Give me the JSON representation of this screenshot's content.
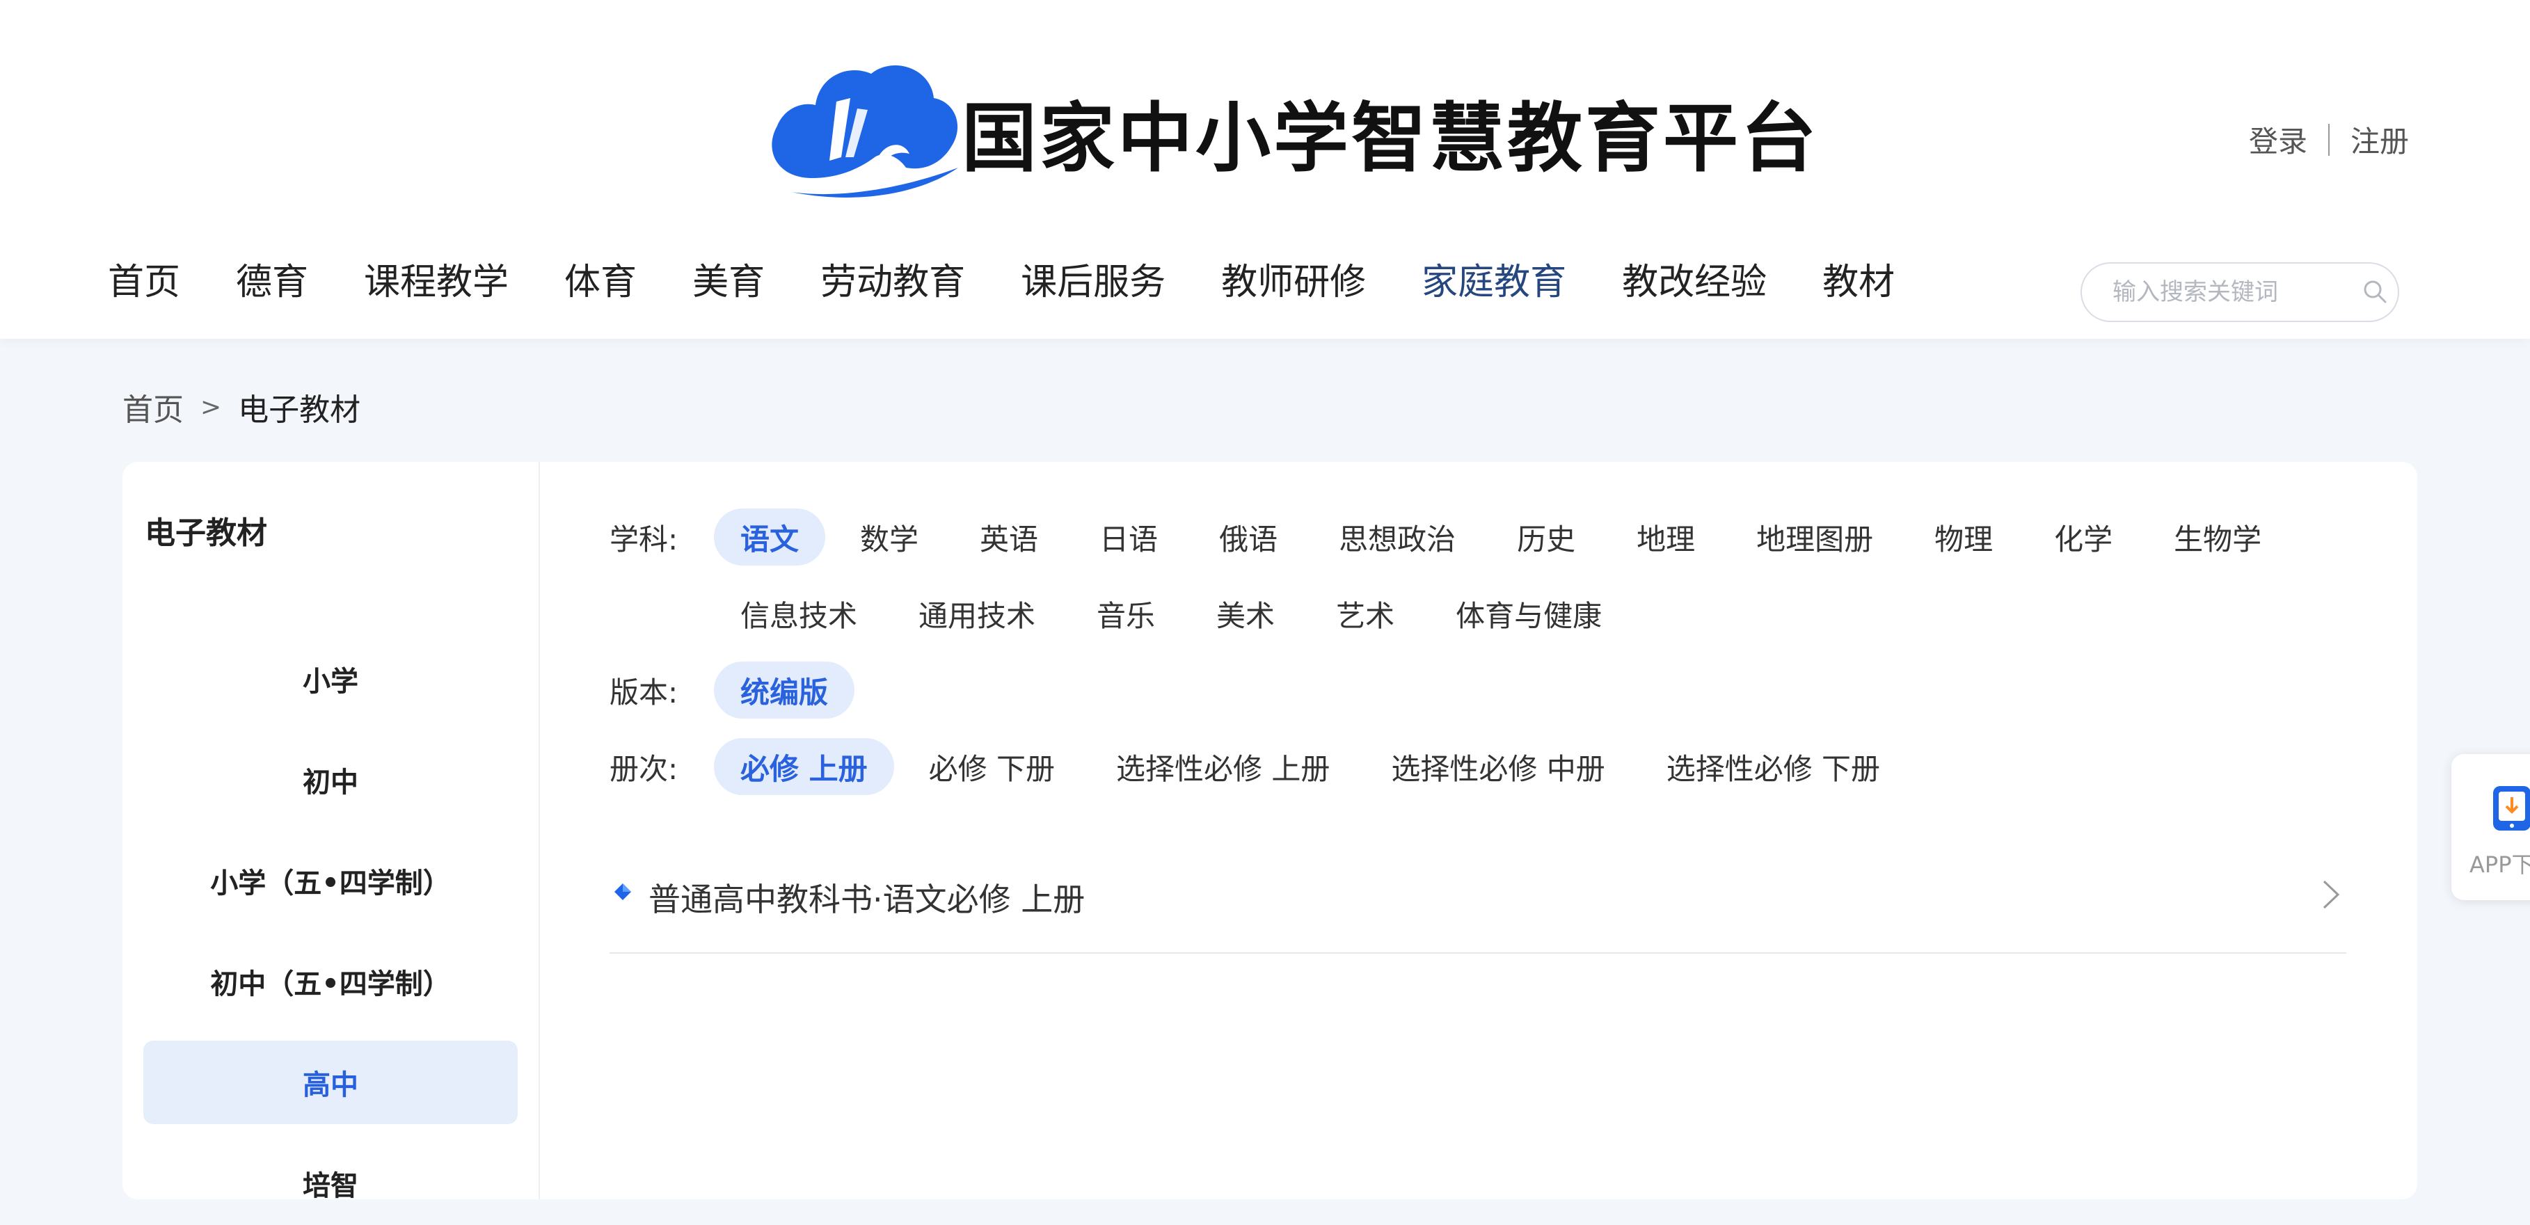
{
  "header": {
    "site_title": "国家中小学智慧教育平台",
    "login": "登录",
    "register": "注册",
    "search_placeholder": "输入搜索关键词"
  },
  "nav": {
    "items": [
      "首页",
      "德育",
      "课程教学",
      "体育",
      "美育",
      "劳动教育",
      "课后服务",
      "教师研修",
      "家庭教育",
      "教改经验",
      "教材"
    ],
    "active": "家庭教育"
  },
  "breadcrumb": {
    "home": "首页",
    "separator": ">",
    "current": "电子教材"
  },
  "sidebar": {
    "title": "电子教材",
    "items": [
      "小学",
      "初中",
      "小学（五•四学制）",
      "初中（五•四学制）",
      "高中",
      "培智"
    ],
    "active": "高中"
  },
  "filters": {
    "subject": {
      "label": "学科:",
      "row1": [
        "语文",
        "数学",
        "英语",
        "日语",
        "俄语",
        "思想政治",
        "历史",
        "地理",
        "地理图册",
        "物理",
        "化学",
        "生物学"
      ],
      "row2": [
        "信息技术",
        "通用技术",
        "音乐",
        "美术",
        "艺术",
        "体育与健康"
      ],
      "active": "语文"
    },
    "edition": {
      "label": "版本:",
      "options": [
        "统编版"
      ],
      "active": "统编版"
    },
    "volume": {
      "label": "册次:",
      "options": [
        "必修 上册",
        "必修 下册",
        "选择性必修 上册",
        "选择性必修 中册",
        "选择性必修 下册"
      ],
      "active": "必修 上册"
    }
  },
  "books": [
    {
      "title": "普通高中教科书·语文必修 上册"
    }
  ],
  "app_widget": {
    "label": "APP下"
  },
  "colors": {
    "accent": "#2a62dd",
    "nav_active": "#25467f",
    "chip_active_bg": "#e3ecfc",
    "page_bg": "#f3f6fb",
    "logo_blue": "#1f66e6"
  }
}
